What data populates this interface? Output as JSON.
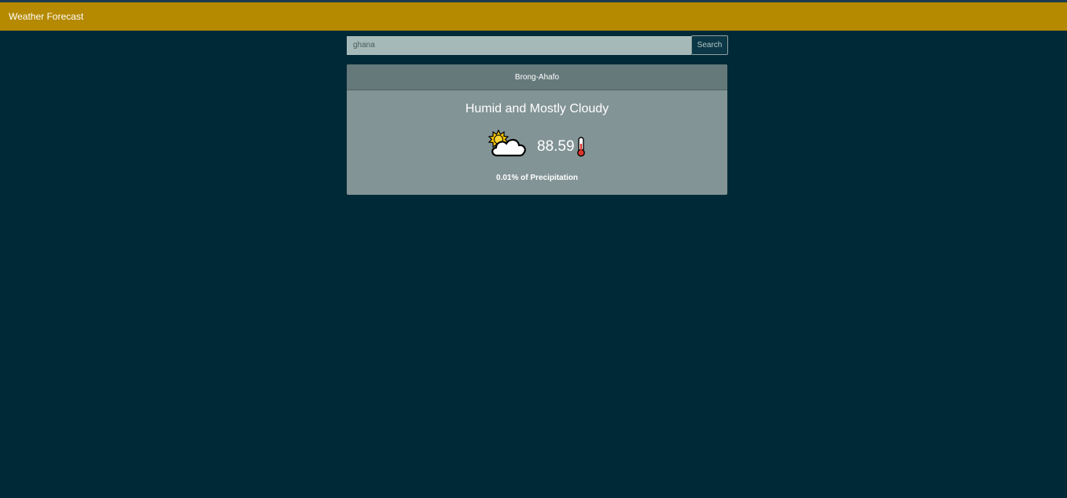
{
  "app": {
    "title": "Weather Forecast"
  },
  "search": {
    "value": "ghana",
    "button_label": "Search"
  },
  "forecast": {
    "location": "Brong-Ahafo",
    "condition": "Humid and Mostly Cloudy",
    "icon": "partly-cloudy-icon",
    "temperature": "88.59",
    "temperature_icon": "thermometer-icon",
    "precipitation": "0.01% of Precipitation"
  },
  "colors": {
    "background": "#002937",
    "navbar": "#b58900",
    "card": "#839496",
    "card_header": "#65797a"
  }
}
